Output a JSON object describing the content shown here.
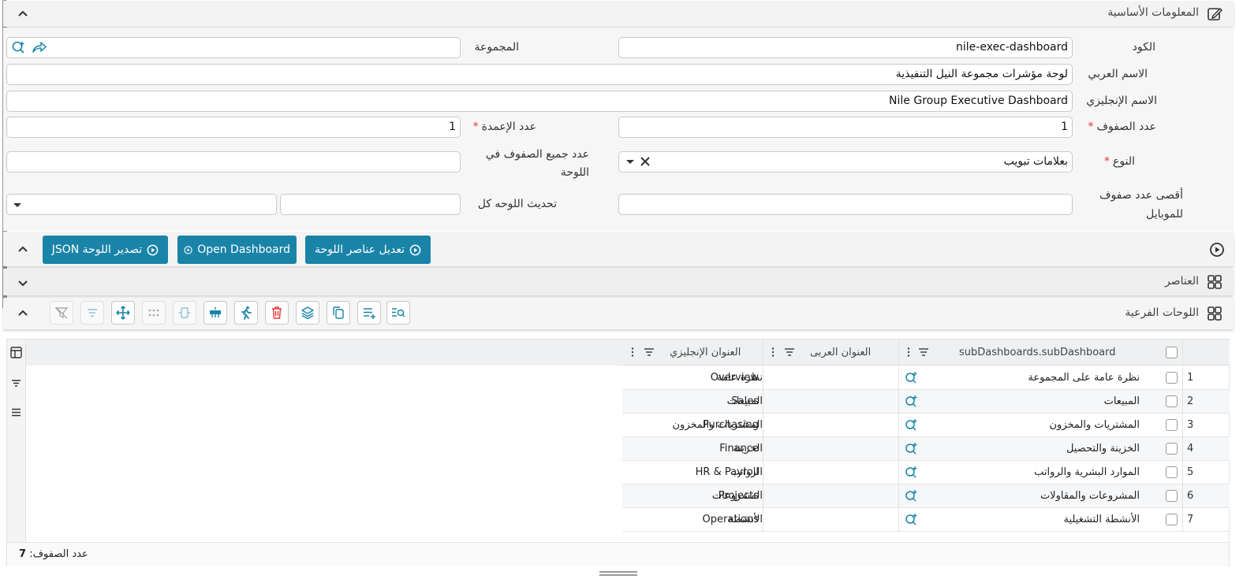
{
  "basic_info": {
    "title": "المعلومات الأساسية",
    "code_label": "الكود",
    "code_value": "nile-exec-dashboard",
    "group_label": "المجموعة",
    "group_value": "",
    "arabic_name_label": "الاسم العربي",
    "arabic_name_value": "لوحة مؤشرات مجموعة النيل التنفيذية",
    "english_name_label": "الاسم الإنجليزي",
    "english_name_value": "Nile Group Executive Dashboard",
    "rows_label": "عدد الصفوف",
    "rows_value": "1",
    "columns_label": "عدد الإعمدة",
    "columns_value": "1",
    "type_label": "النوع",
    "type_value": "بعلامات تبويب",
    "all_rows_label": "عدد جميع الصفوف في اللوحة",
    "all_rows_value": "",
    "mobile_rows_label": "أقصى عدد صفوف للموبايل",
    "mobile_rows_value": "",
    "refresh_label": "تحديث اللوحه كل",
    "refresh_value": "",
    "refresh_unit_value": "",
    "required_mark": "*"
  },
  "actions": {
    "edit_items": "تعديل عناصر اللوحة",
    "open_dashboard": "Open Dashboard",
    "export_json": "تصدير اللوحة JSON"
  },
  "elements_section": {
    "title": "العناصر"
  },
  "subdash_section": {
    "title": "اللوحات الفرعية"
  },
  "grid": {
    "columns": {
      "subdashboard": "subDashboards.subDashboard",
      "arabic_title": "العنوان العربى",
      "english_title": "العنوان الإنجليزي"
    },
    "rows": [
      {
        "num": "1",
        "sub": "نظرة عامة على المجموعة",
        "ar": "نظرة عامة",
        "en": "Overview"
      },
      {
        "num": "2",
        "sub": "المبيعات",
        "ar": "المبيعات",
        "en": "Sales"
      },
      {
        "num": "3",
        "sub": "المشتريات والمخزون",
        "ar": "المشتريات والمخزون",
        "en": "Purchasing"
      },
      {
        "num": "4",
        "sub": "الخزينة والتحصيل",
        "ar": "الخزينة",
        "en": "Finance"
      },
      {
        "num": "5",
        "sub": "الموارد البشرية والرواتب",
        "ar": "الرواتب",
        "en": "HR & Payroll"
      },
      {
        "num": "6",
        "sub": "المشروعات والمقاولات",
        "ar": "المشروعات",
        "en": "Projects"
      },
      {
        "num": "7",
        "sub": "الأنشطة التشغيلية",
        "ar": "الأنشطة",
        "en": "Operations"
      }
    ],
    "footer_label": "عدد الصفوف:",
    "footer_count": "7"
  },
  "colors": {
    "accent": "#1a84a8",
    "danger": "#e53935"
  },
  "icons": {
    "basic_info": "edit-icon",
    "action_bar": "play-circle-icon",
    "elements": "grid-icon",
    "subdash": "grid-icon",
    "toolbar": [
      "filter-off-icon",
      "filter-icon",
      "move-icon",
      "dots-grid-icon",
      "resize-icon",
      "insert-row-icon",
      "run-icon",
      "delete-icon",
      "layers-icon",
      "copy-icon",
      "add-list-icon",
      "search-list-icon"
    ]
  }
}
